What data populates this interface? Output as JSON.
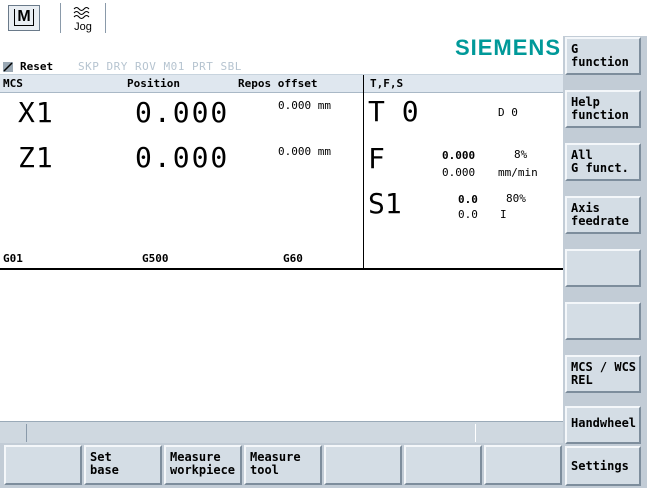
{
  "header": {
    "mode_label": "M",
    "jog_label": "Jog"
  },
  "brand": "SIEMENS",
  "status": {
    "reset": "Reset",
    "program_flags": "SKP DRY ROV M01 PRT SBL"
  },
  "columns": {
    "mcs": "MCS",
    "position": "Position",
    "repos": "Repos offset",
    "tfs": "T,F,S"
  },
  "axes": [
    {
      "name": "X1",
      "position": "0.000",
      "repos": "0.000 mm"
    },
    {
      "name": "Z1",
      "position": "0.000",
      "repos": "0.000 mm"
    }
  ],
  "gcodes": [
    "G01",
    "G500",
    "G60"
  ],
  "tfs": {
    "t_label": "T 0",
    "d_label": "D 0",
    "f_label": "F",
    "f_actual": "0.000",
    "f_set": "0.000",
    "f_override": "8%",
    "f_unit": "mm/min",
    "s_label": "S1",
    "s_actual": "0.0",
    "s_set": "0.0",
    "s_override": "80%",
    "s_dir": "I"
  },
  "softkeys_vertical": [
    "G\nfunction",
    "Help\nfunction",
    "All\nG funct.",
    "Axis\nfeedrate",
    "",
    "",
    "MCS / WCS\nREL",
    "Handwheel",
    "Settings"
  ],
  "softkeys_horizontal": [
    "",
    "Set\nbase",
    "Measure\nworkpiece",
    "Measure\ntool",
    "",
    "",
    ""
  ],
  "colors": {
    "brand": "#009999",
    "softkey_bg": "#d4dde5",
    "header_bg": "#dfe7ef"
  }
}
